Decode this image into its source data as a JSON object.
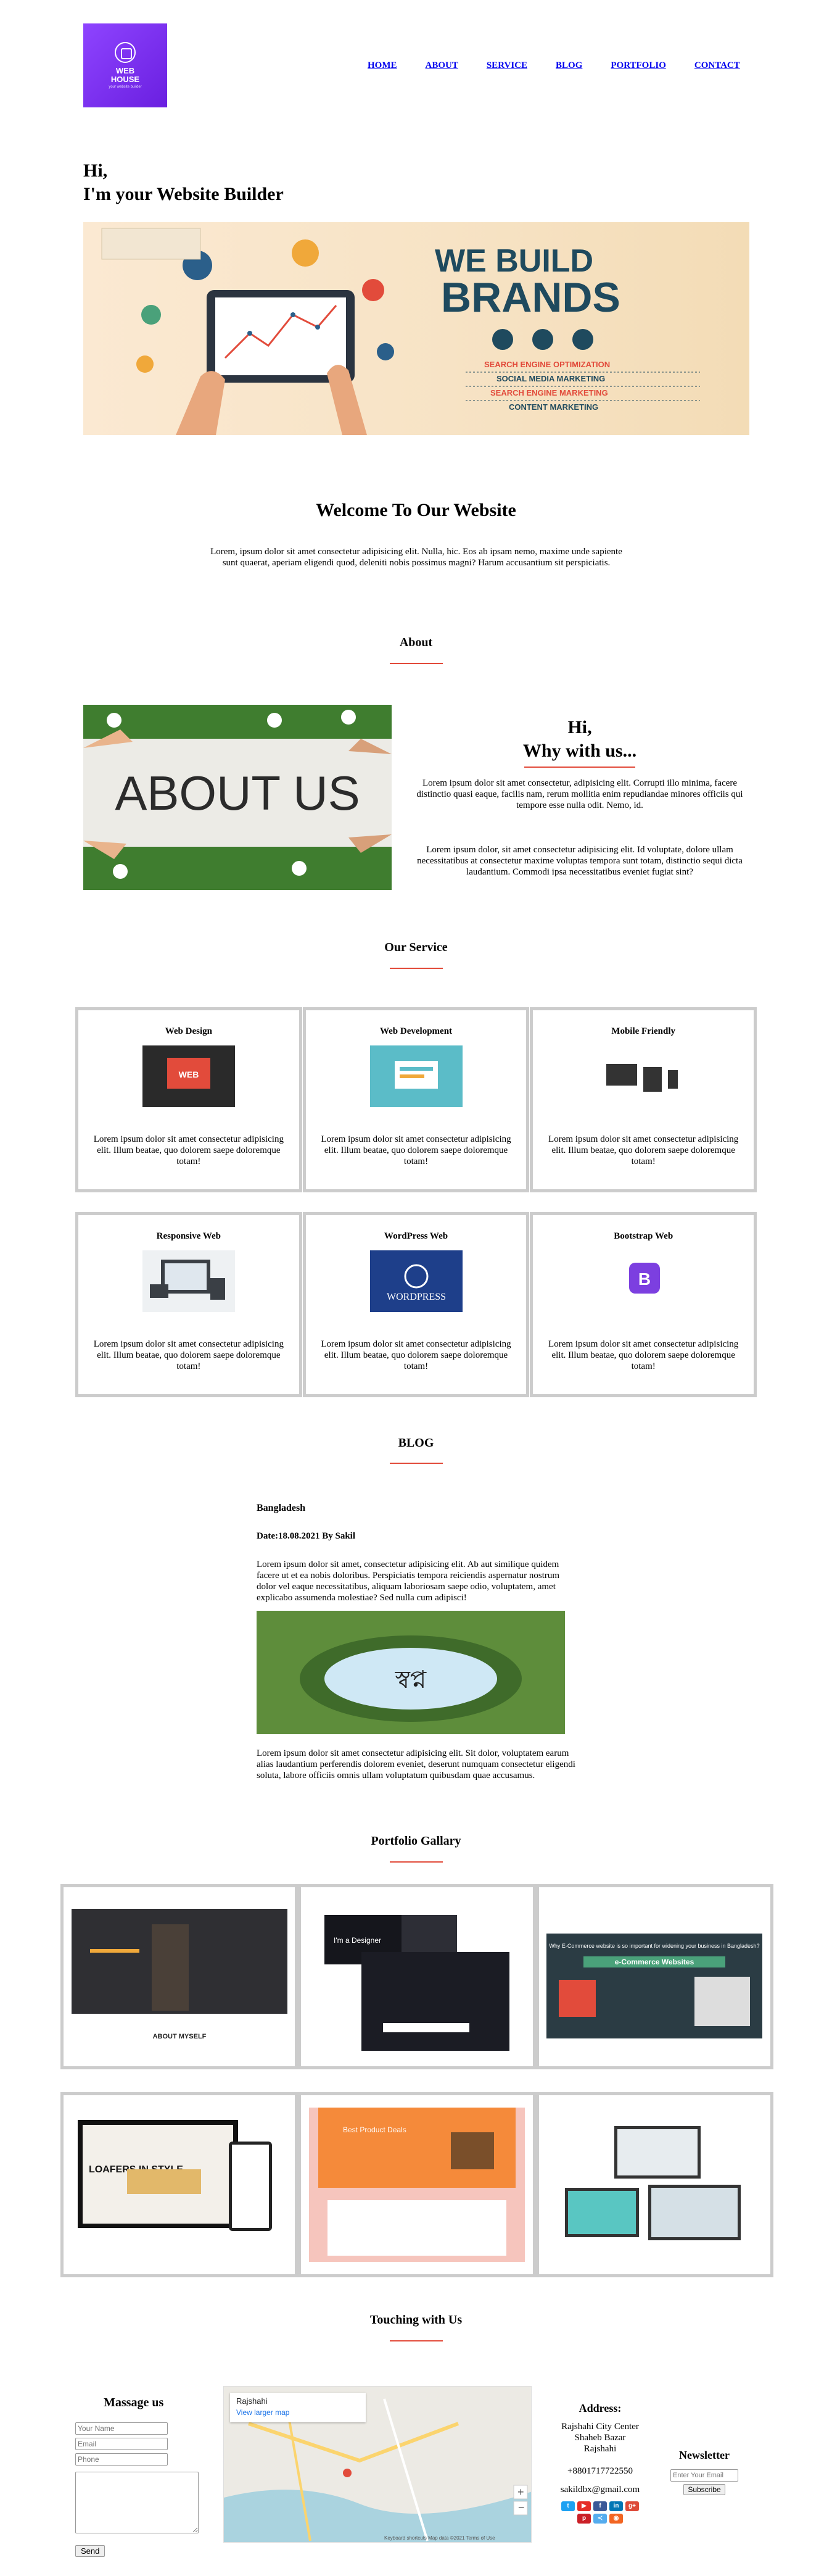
{
  "logo": {
    "line1": "WEB",
    "line2": "HOUSE",
    "tagline": "your website builder"
  },
  "nav": {
    "home": "HOME",
    "about": "ABOUT",
    "service": "SERVICE",
    "blog": "BLOG",
    "portfolio": "PORTFOLIO",
    "contact": "CONTACT"
  },
  "hero": {
    "line1": "Hi,",
    "line2": "I'm your Website Builder"
  },
  "banner": {
    "headline1": "WE BUILD",
    "headline2": "BRANDS",
    "items": [
      "SEARCH ENGINE OPTIMIZATION",
      "SOCIAL MEDIA MARKETING",
      "SEARCH ENGINE MARKETING",
      "CONTENT MARKETING"
    ]
  },
  "welcome": {
    "title": "Welcome To Our Website",
    "text": "Lorem, ipsum dolor sit amet consectetur adipisicing elit. Nulla, hic. Eos ab ipsam nemo, maxime unde sapiente sunt quaerat, aperiam eligendi quod, deleniti nobis possimus magni? Harum accusantium sit perspiciatis."
  },
  "about": {
    "title": "About",
    "image_text": "ABOUT US",
    "heading1": "Hi,",
    "heading2": "Why with us...",
    "p1": "Lorem ipsum dolor sit amet consectetur, adipisicing elit. Corrupti illo minima, facere distinctio quasi eaque, facilis nam, rerum mollitia enim repudiandae minores officiis qui tempore esse nulla odit. Nemo, id.",
    "p2": "Lorem ipsum dolor, sit amet consectetur adipisicing elit. Id voluptate, dolore ullam necessitatibus at consectetur maxime voluptas tempora sunt totam, distinctio sequi dicta laudantium. Commodi ipsa necessitatibus eveniet fugiat sint?"
  },
  "services": {
    "title": "Our Service",
    "items": [
      {
        "title": "Web Design",
        "text": "Lorem ipsum dolor sit amet consectetur adipisicing elit. Illum beatae, quo dolorem saepe doloremque totam!"
      },
      {
        "title": "Web Development",
        "text": "Lorem ipsum dolor sit amet consectetur adipisicing elit. Illum beatae, quo dolorem saepe doloremque totam!"
      },
      {
        "title": "Mobile Friendly",
        "text": "Lorem ipsum dolor sit amet consectetur adipisicing elit. Illum beatae, quo dolorem saepe doloremque totam!"
      },
      {
        "title": "Responsive Web",
        "text": "Lorem ipsum dolor sit amet consectetur adipisicing elit. Illum beatae, quo dolorem saepe doloremque totam!"
      },
      {
        "title": "WordPress Web",
        "text": "Lorem ipsum dolor sit amet consectetur adipisicing elit. Illum beatae, quo dolorem saepe doloremque totam!"
      },
      {
        "title": "Bootstrap Web",
        "text": "Lorem ipsum dolor sit amet consectetur adipisicing elit. Illum beatae, quo dolorem saepe doloremque totam!"
      }
    ]
  },
  "blog": {
    "title": "BLOG",
    "post_title": "Bangladesh",
    "date": "Date:18.08.2021 By Sakil",
    "p1": "Lorem ipsum dolor sit amet, consectetur adipisicing elit. Ab aut similique quidem facere ut et ea nobis doloribus. Perspiciatis tempora reiciendis aspernatur nostrum dolor vel eaque necessitatibus, aliquam laboriosam saepe odio, voluptatem, amet explicabo assumenda molestiae? Sed nulla cum adipisci!",
    "p2": "Lorem ipsum dolor sit amet consectetur adipisicing elit. Sit dolor, voluptatem earum alias laudantium perferendis dolorem eveniet, deserunt numquam consectetur eligendi soluta, labore officiis omnis ullam voluptatum quibusdam quae accusamus.",
    "image_text": "স্বপ্ন"
  },
  "portfolio": {
    "title": "Portfolio Gallary",
    "items": [
      "Portfolio 1",
      "Portfolio 2",
      "Portfolio 3",
      "Portfolio 4",
      "Portfolio 5",
      "Portfolio 6"
    ],
    "p1_text": "ABOUT MYSELF",
    "p2_text": "I'm a Designer",
    "p3_text": "Why E-Commerce website is so important for widening your business in Bangladesh?",
    "p3_badge": "e-Commerce Websites",
    "p4_text": "LOAFERS IN STYLE",
    "p5_text": "Best Product Deals"
  },
  "contact": {
    "title": "Touching with Us",
    "form_title": "Massage us",
    "name_placeholder": "Your Name",
    "email_placeholder": "Email",
    "phone_placeholder": "Phone",
    "send_label": "Send",
    "map_place": "Rajshahi",
    "map_link": "View larger map",
    "map_footer": "Keyboard shortcuts   Map data ©2021   Terms of Use",
    "address_title": "Address:",
    "address_line1": "Rajshahi City Center",
    "address_line2": "Shaheb Bazar",
    "address_line3": "Rajshahi",
    "phone": "+8801717722550",
    "email": "sakildbx@gmail.com",
    "newsletter_title": "Newsletter",
    "newsletter_placeholder": "Enter Your Email",
    "subscribe_label": "Subscribe"
  },
  "colors": {
    "accent": "#e24b3b",
    "logo_purple": "#7b2ff0",
    "link": "#0000ee",
    "card_border": "#cccccc"
  }
}
